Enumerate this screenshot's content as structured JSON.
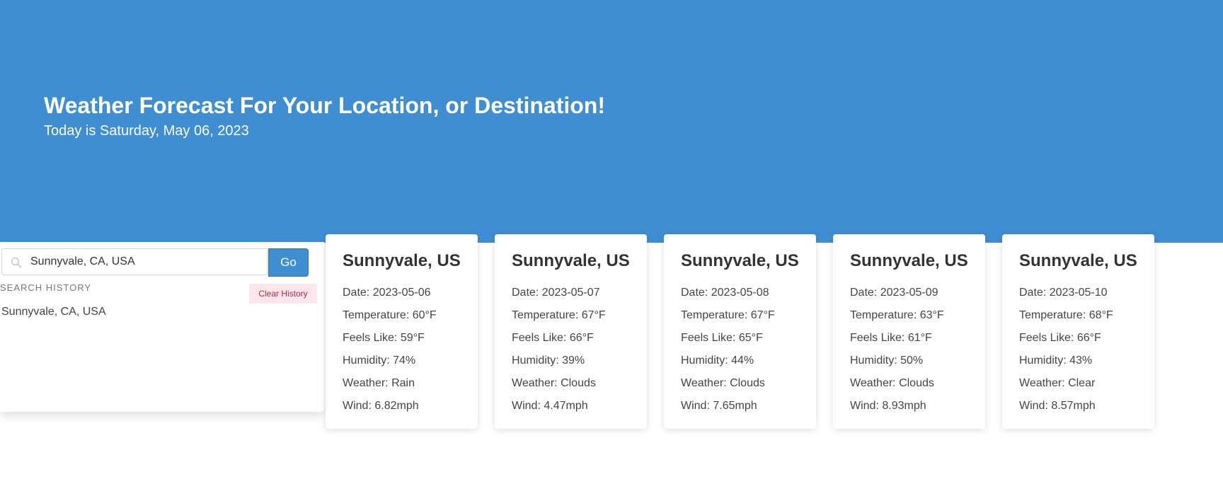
{
  "header": {
    "title": "Weather Forecast For Your Location, or Destination!",
    "subtitle": "Today is Saturday, May 06, 2023"
  },
  "search": {
    "value": "Sunnyvale, CA, USA",
    "icon": "search-icon",
    "button_label": "Go"
  },
  "history": {
    "title": "SEARCH HISTORY",
    "clear_label": "Clear History",
    "items": [
      "Sunnyvale, CA, USA"
    ]
  },
  "forecast": [
    {
      "city": "Sunnyvale, US",
      "date": "Date: 2023-05-06",
      "temperature": "Temperature: 60°F",
      "feels_like": "Feels Like: 59°F",
      "humidity": "Humidity: 74%",
      "weather": "Weather: Rain",
      "wind": "Wind: 6.82mph"
    },
    {
      "city": "Sunnyvale, US",
      "date": "Date: 2023-05-07",
      "temperature": "Temperature: 67°F",
      "feels_like": "Feels Like: 66°F",
      "humidity": "Humidity: 39%",
      "weather": "Weather: Clouds",
      "wind": "Wind: 4.47mph"
    },
    {
      "city": "Sunnyvale, US",
      "date": "Date: 2023-05-08",
      "temperature": "Temperature: 67°F",
      "feels_like": "Feels Like: 65°F",
      "humidity": "Humidity: 44%",
      "weather": "Weather: Clouds",
      "wind": "Wind: 7.65mph"
    },
    {
      "city": "Sunnyvale, US",
      "date": "Date: 2023-05-09",
      "temperature": "Temperature: 63°F",
      "feels_like": "Feels Like: 61°F",
      "humidity": "Humidity: 50%",
      "weather": "Weather: Clouds",
      "wind": "Wind: 8.93mph"
    },
    {
      "city": "Sunnyvale, US",
      "date": "Date: 2023-05-10",
      "temperature": "Temperature: 68°F",
      "feels_like": "Feels Like: 66°F",
      "humidity": "Humidity: 43%",
      "weather": "Weather: Clear",
      "wind": "Wind: 8.57mph"
    }
  ],
  "colors": {
    "hero_background": "#3f8ed1",
    "go_button": "#3f8ed1",
    "clear_button_background": "#fde6ec",
    "clear_button_text": "#b2274c"
  }
}
